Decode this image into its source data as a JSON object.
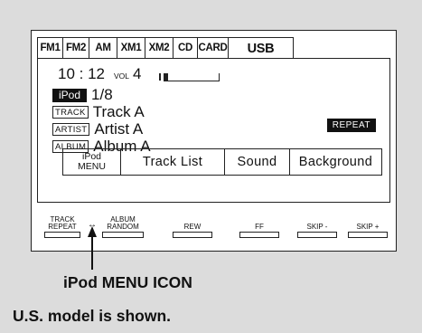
{
  "tabs": [
    "FM1",
    "FM2",
    "AM",
    "XM1",
    "XM2",
    "CD",
    "CARD",
    "USB"
  ],
  "status": {
    "time": "10 : 12",
    "vol_label": "VOL",
    "vol_value": "4",
    "ipod_label": "iPod",
    "track_position": "1/8",
    "repeat_badge": "REPEAT"
  },
  "info": {
    "track_tag": "TRACK",
    "track_value": "Track A",
    "artist_tag": "ARTIST",
    "artist_value": "Artist A",
    "album_tag": "ALBUM",
    "album_value": "Album A"
  },
  "menu": {
    "ipod_line1": "iPod",
    "ipod_line2": "MENU",
    "track_list": "Track List",
    "sound": "Sound",
    "background": "Background"
  },
  "hw_buttons": {
    "track_repeat_1": "TRACK",
    "track_repeat_2": "REPEAT",
    "album_random_1": "ALBUM",
    "album_random_2": "RANDOM",
    "rew": "REW",
    "ff": "FF",
    "skip_minus": "SKIP -",
    "skip_plus": "SKIP +"
  },
  "callout": "iPod MENU ICON",
  "note": "U.S. model is shown."
}
